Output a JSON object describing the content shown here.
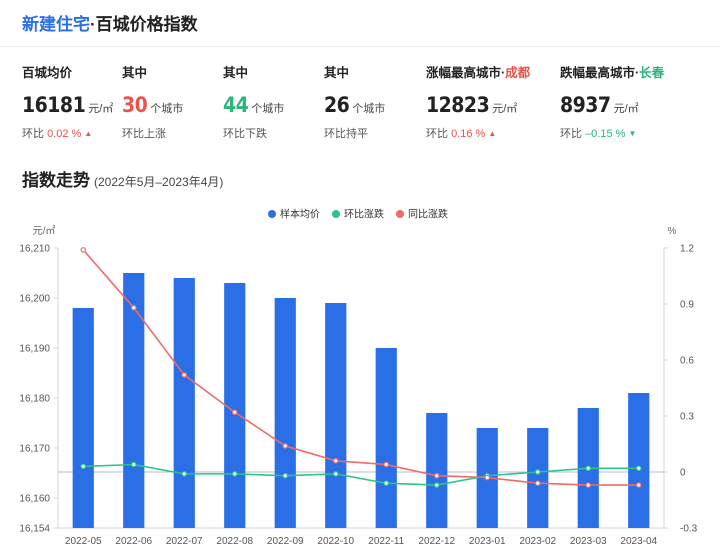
{
  "header": {
    "brand": "新建住宅",
    "title": "·百城价格指数"
  },
  "stats": [
    {
      "label": "百城均价",
      "value": "16181",
      "unit": "元/㎡",
      "sub_prefix": "环比",
      "sub_value": "0.02 %",
      "trend": "up"
    },
    {
      "label": "其中",
      "value": "30",
      "unit": "个城市",
      "sub_text": "环比上涨",
      "trend": "up"
    },
    {
      "label": "其中",
      "value": "44",
      "unit": "个城市",
      "sub_text": "环比下跌",
      "trend": "down"
    },
    {
      "label": "其中",
      "value": "26",
      "unit": "个城市",
      "sub_text": "环比持平",
      "trend": "flat"
    },
    {
      "label": "涨幅最高城市·",
      "label_city": "成都",
      "value": "12823",
      "unit": "元/㎡",
      "sub_prefix": "环比",
      "sub_value": "0.16 %",
      "trend": "up"
    },
    {
      "label": "跌幅最高城市·",
      "label_city": "长春",
      "value": "8937",
      "unit": "元/㎡",
      "sub_prefix": "环比",
      "sub_value": "–0.15 %",
      "trend": "down"
    }
  ],
  "section": {
    "title": "指数走势",
    "range": "(2022年5月–2023年4月)"
  },
  "colors": {
    "bar": "#2b6fe6",
    "mom": "#2bc48a",
    "yoy": "#ee6b66",
    "up": "#e8544e",
    "down": "#2bb57a"
  },
  "chart_data": {
    "type": "bar",
    "categories": [
      "2022-05",
      "2022-06",
      "2022-07",
      "2022-08",
      "2022-09",
      "2022-10",
      "2022-11",
      "2022-12",
      "2023-01",
      "2023-02",
      "2023-03",
      "2023-04"
    ],
    "series": [
      {
        "name": "样本均价",
        "type": "bar",
        "axis": "left",
        "values": [
          16198,
          16205,
          16204,
          16203,
          16200,
          16199,
          16190,
          16177,
          16174,
          16174,
          16178,
          16181
        ]
      },
      {
        "name": "环比涨跌",
        "type": "line",
        "axis": "right",
        "values": [
          0.03,
          0.04,
          -0.01,
          -0.01,
          -0.02,
          -0.01,
          -0.06,
          -0.07,
          -0.02,
          0.0,
          0.02,
          0.02
        ]
      },
      {
        "name": "同比涨跌",
        "type": "line",
        "axis": "right",
        "values": [
          1.19,
          0.88,
          0.52,
          0.32,
          0.14,
          0.06,
          0.04,
          -0.02,
          -0.03,
          -0.06,
          -0.07,
          -0.07
        ]
      }
    ],
    "left_axis": {
      "label": "元/㎡",
      "ylim": [
        16154,
        16210
      ],
      "ticks": [
        16154,
        16160,
        16170,
        16180,
        16190,
        16200,
        16210
      ]
    },
    "right_axis": {
      "label": "%",
      "ylim": [
        -0.3,
        1.2
      ],
      "ticks": [
        "-0.3",
        "0",
        "0.3",
        "0.6",
        "0.9",
        "1.2"
      ]
    },
    "legend": "top-center",
    "grid": false
  }
}
